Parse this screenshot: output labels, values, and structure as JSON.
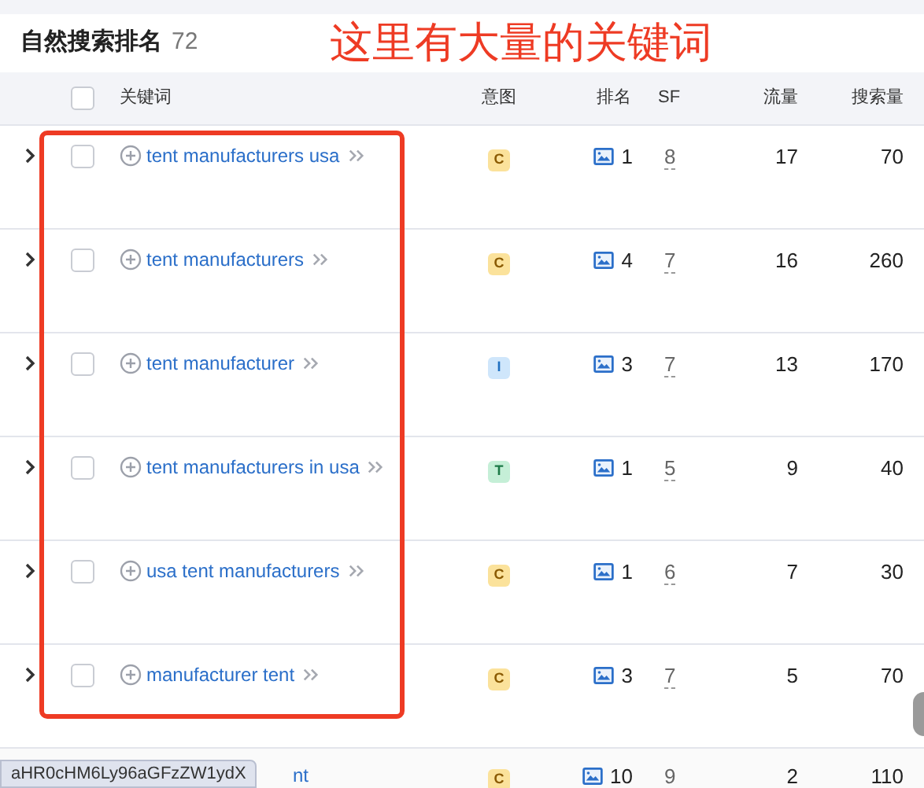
{
  "panel": {
    "title": "自然搜索排名",
    "count": "72"
  },
  "annotation": "这里有大量的关键词",
  "table": {
    "select_all_checked": false,
    "columns": [
      "关键词",
      "意图",
      "排名",
      "SF",
      "流量",
      "搜索量"
    ],
    "rows": [
      {
        "expanded": false,
        "checked": false,
        "keyword": "tent manufacturers usa",
        "intent": {
          "label": "C",
          "kind": "commercial"
        },
        "rank": "1",
        "sf": "8",
        "traffic": "17",
        "volume": "70"
      },
      {
        "expanded": false,
        "checked": false,
        "keyword": "tent manufacturers",
        "intent": {
          "label": "C",
          "kind": "commercial"
        },
        "rank": "4",
        "sf": "7",
        "traffic": "16",
        "volume": "260"
      },
      {
        "expanded": false,
        "checked": false,
        "keyword": "tent manufacturer",
        "intent": {
          "label": "I",
          "kind": "informational"
        },
        "rank": "3",
        "sf": "7",
        "traffic": "13",
        "volume": "170"
      },
      {
        "expanded": false,
        "checked": false,
        "keyword": "tent manufacturers in usa",
        "intent": {
          "label": "T",
          "kind": "transactional"
        },
        "rank": "1",
        "sf": "5",
        "traffic": "9",
        "volume": "40"
      },
      {
        "expanded": false,
        "checked": false,
        "keyword": "usa tent manufacturers",
        "intent": {
          "label": "C",
          "kind": "commercial"
        },
        "rank": "1",
        "sf": "6",
        "traffic": "7",
        "volume": "30"
      },
      {
        "expanded": false,
        "checked": false,
        "keyword": "manufacturer tent",
        "intent": {
          "label": "C",
          "kind": "commercial"
        },
        "rank": "3",
        "sf": "7",
        "traffic": "5",
        "volume": "70"
      },
      {
        "keyword": "nt",
        "intent": {
          "label": "C",
          "kind": "commercial"
        },
        "rank": "10",
        "sf": "9",
        "traffic": "2",
        "volume": "110"
      }
    ]
  },
  "status_url": "aHR0cHM6Ly96aGFzZW1ydX"
}
